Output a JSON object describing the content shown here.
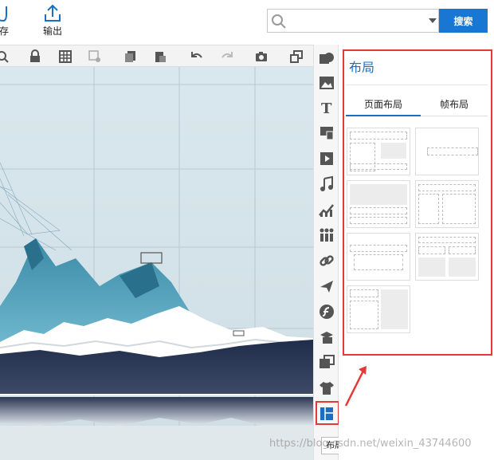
{
  "topbar": {
    "save_label": "存",
    "export_label": "输出",
    "search": {
      "placeholder": "",
      "button_label": "搜索"
    }
  },
  "side_toolbar": {
    "items": [
      "shape-icon",
      "image-icon",
      "text-icon",
      "flag-icon",
      "video-icon",
      "music-icon",
      "chart-icon",
      "people-icon",
      "link-icon",
      "plane-icon",
      "flash-icon",
      "stack-icon",
      "gallery-icon",
      "shirt-icon",
      "layout-icon"
    ],
    "tooltip": "布局"
  },
  "panel": {
    "title": "布局",
    "tabs": [
      {
        "label": "页面布局",
        "active": true
      },
      {
        "label": "帧布局",
        "active": false
      }
    ]
  },
  "watermark": "https://blog.csdn.net/weixin_43744600",
  "colors": {
    "accent": "#1a6fc4",
    "highlight": "#e53935",
    "search_button": "#1877d2"
  }
}
